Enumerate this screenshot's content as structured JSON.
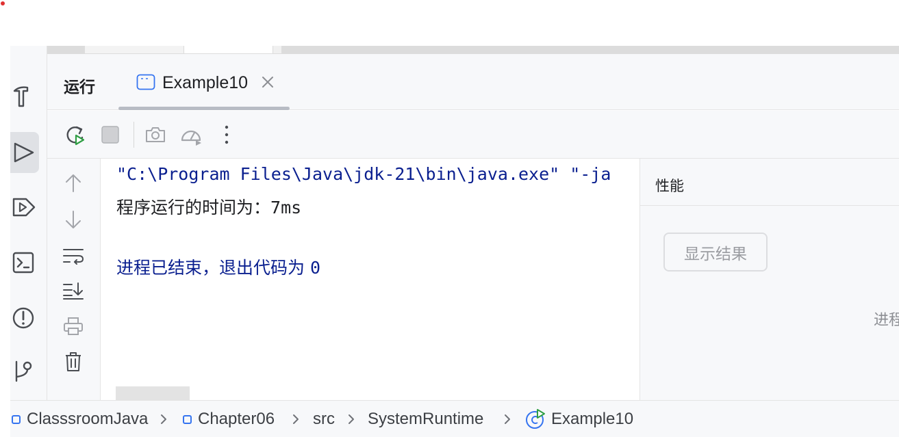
{
  "run_window": {
    "title": "运行",
    "tab_label": "Example10"
  },
  "toolbar": {
    "icons": [
      "rerun-icon",
      "stop-icon",
      "camera-icon",
      "profiler-icon",
      "more-icon"
    ]
  },
  "console": {
    "line1": "\"C:\\Program Files\\Java\\jdk-21\\bin\\java.exe\" \"-ja",
    "line2_label": "程序运行的时间为：",
    "line2_value": "7ms",
    "line3_label": "进程已结束，退出代码为 ",
    "line3_code": "0"
  },
  "perf_panel": {
    "title": "性能",
    "button_label": "显示结果",
    "process_text": "进程"
  },
  "breadcrumb": {
    "items": [
      "ClasssroomJava",
      "Chapter06",
      "src",
      "SystemRuntime",
      "Example10"
    ]
  },
  "colors": {
    "console_blue": "#0a1f8f",
    "accent": "#3574f0"
  }
}
